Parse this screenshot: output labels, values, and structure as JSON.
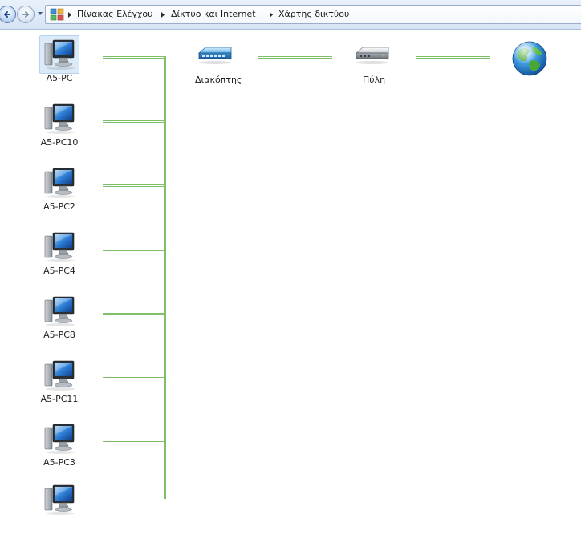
{
  "breadcrumb": {
    "items": [
      "Πίνακας Ελέγχου",
      "Δίκτυο και Internet",
      "Χάρτης δικτύου"
    ]
  },
  "icons": {
    "back": "back-arrow-icon",
    "forward": "forward-arrow-icon",
    "history": "chevron-down-icon",
    "location": "control-panel-icon",
    "computer": "computer-icon",
    "switch": "switch-icon",
    "gateway": "gateway-icon",
    "internet": "globe-icon"
  },
  "network": {
    "computers": [
      {
        "label": "A5-PC",
        "selected": true
      },
      {
        "label": "A5-PC10"
      },
      {
        "label": "A5-PC2"
      },
      {
        "label": "A5-PC4"
      },
      {
        "label": "A5-PC8"
      },
      {
        "label": "A5-PC11"
      },
      {
        "label": "A5-PC3"
      }
    ],
    "switch_label": "Διακόπτης",
    "gateway_label": "Πύλη"
  },
  "colors": {
    "link": "#7fbf6a",
    "selection": "#dbeaf9"
  }
}
